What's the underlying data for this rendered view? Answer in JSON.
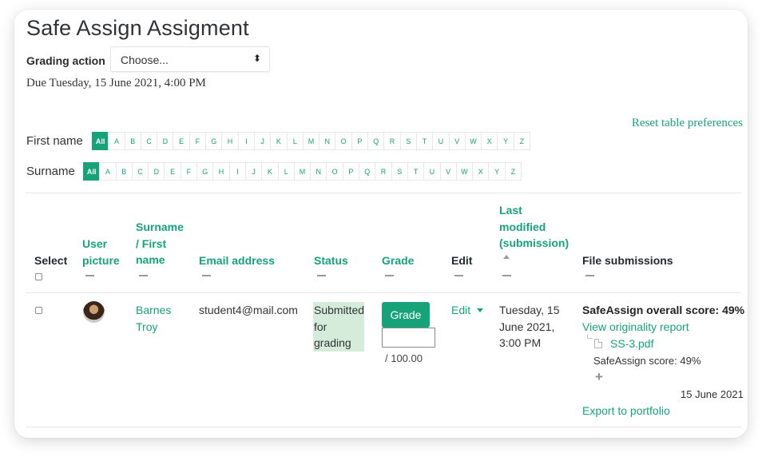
{
  "page": {
    "title": "Safe Assign Assigment",
    "grading_action_label": "Grading action",
    "grading_action_value": "Choose...",
    "due": "Due Tuesday, 15 June 2021, 4:00 PM",
    "reset_link": "Reset table preferences"
  },
  "filters": {
    "first_name_label": "First name",
    "surname_label": "Surname",
    "all_label": "All",
    "letters": [
      "A",
      "B",
      "C",
      "D",
      "E",
      "F",
      "G",
      "H",
      "I",
      "J",
      "K",
      "L",
      "M",
      "N",
      "O",
      "P",
      "Q",
      "R",
      "S",
      "T",
      "U",
      "V",
      "W",
      "X",
      "Y",
      "Z"
    ],
    "selected": "All"
  },
  "table": {
    "headers": {
      "select": "Select",
      "user_picture": [
        "User",
        "picture"
      ],
      "surname_first": [
        "Surname",
        "/ First",
        "name"
      ],
      "email": "Email address",
      "status": "Status",
      "grade": "Grade",
      "edit": "Edit",
      "last_modified": [
        "Last",
        "modified",
        "(submission)"
      ],
      "file_submissions": "File submissions"
    },
    "row": {
      "name_line1": "Barnes",
      "name_line2": "Troy",
      "email": "student4@mail.com",
      "status_lines": [
        "Submitted",
        "for",
        "grading"
      ],
      "grade_button": "Grade",
      "grade_out_of": "/ 100.00",
      "edit_label": "Edit",
      "modified_lines": [
        "Tuesday, 15",
        "June 2021,",
        "3:00 PM"
      ],
      "overall_score": "SafeAssign overall score: 49%",
      "originality_link": "View originality report",
      "file_name": "SS-3.pdf",
      "file_score": "SafeAssign score: 49%",
      "file_date": "15 June 2021",
      "export_link": "Export to portfolio"
    }
  },
  "colors": {
    "accent": "#16a37a",
    "status_bg": "#d4ecd9"
  },
  "icons": [
    "select-caret-icon",
    "sort-asc-icon",
    "collapse-dash-icon",
    "avatar",
    "edit-dropdown-icon",
    "file-pdf-icon",
    "plus-icon"
  ]
}
